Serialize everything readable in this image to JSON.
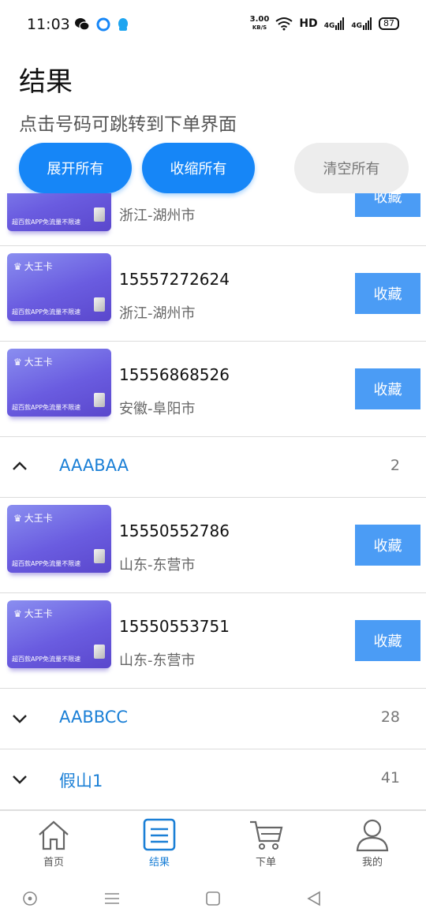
{
  "status_bar": {
    "time": "11:03",
    "speed_value": "3.00",
    "speed_unit": "KB/S",
    "hd": "HD",
    "net1": "4G",
    "net2": "4G",
    "battery": "87"
  },
  "header": {
    "title": "结果",
    "hint": "点击号码可跳转到下单界面"
  },
  "actions": {
    "expand_all": "展开所有",
    "collapse_all": "收缩所有",
    "clear_all": "清空所有"
  },
  "sim_card": {
    "brand": "大王卡",
    "slogan": "超百款APP免流量不限速"
  },
  "list": {
    "partial_item": {
      "city": "浙江-湖州市",
      "fav": "收藏"
    },
    "items_group1": [
      {
        "number": "15557272624",
        "city": "浙江-湖州市",
        "fav": "收藏"
      },
      {
        "number": "15556868526",
        "city": "安徽-阜阳市",
        "fav": "收藏"
      }
    ],
    "group_aaabaa": {
      "title": "AAABAA",
      "count": "2",
      "expanded": true
    },
    "items_group2": [
      {
        "number": "15550552786",
        "city": "山东-东营市",
        "fav": "收藏"
      },
      {
        "number": "15550553751",
        "city": "山东-东营市",
        "fav": "收藏"
      }
    ],
    "group_aabbcc": {
      "title": "AABBCC",
      "count": "28",
      "expanded": false
    },
    "group_jiashan": {
      "title": "假山1",
      "count": "41",
      "expanded": false
    }
  },
  "bottom_nav": {
    "home": "首页",
    "results": "结果",
    "order": "下单",
    "mine": "我的",
    "active": "results"
  },
  "colors": {
    "accent": "#1686f7",
    "fav_button": "#4b9cf5",
    "group_title": "#1a7fd6"
  },
  "icons": {
    "chevron_up": "chevron-up-icon",
    "chevron_down": "chevron-down-icon",
    "home": "home-icon",
    "results": "list-icon",
    "order": "cart-icon",
    "mine": "user-icon"
  }
}
